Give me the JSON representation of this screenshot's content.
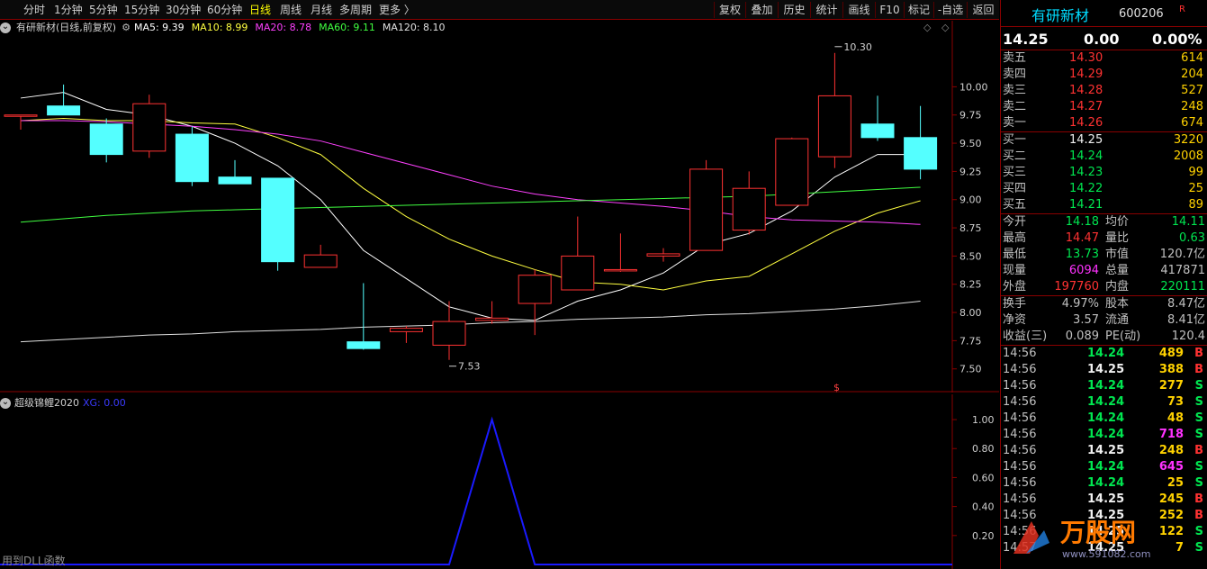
{
  "toolbar": {
    "tabs": [
      "分时",
      "1分钟",
      "5分钟",
      "15分钟",
      "30分钟",
      "60分钟",
      "日线",
      "周线",
      "月线",
      "多周期",
      "更多 〉"
    ],
    "active_tab": "日线",
    "tools": [
      "复权",
      "叠加",
      "历史",
      "统计",
      "画线",
      "F10",
      "标记",
      "-自选",
      "返回"
    ]
  },
  "main_legend": {
    "title": "有研新材(日线,前复权)",
    "ma": [
      {
        "label": "MA5: 9.39",
        "color": "#ffffff"
      },
      {
        "label": "MA10: 8.99",
        "color": "#ffff40"
      },
      {
        "label": "MA20: 8.78",
        "color": "#ff40ff"
      },
      {
        "label": "MA60: 9.11",
        "color": "#40ff40"
      },
      {
        "label": "MA120: 8.10",
        "color": "#e0e0e0"
      }
    ]
  },
  "sub_legend": {
    "title": "超级锦鲤2020",
    "xg": "XG: 0.00"
  },
  "chart_data": [
    {
      "type": "candlestick",
      "title": "有研新材(日线,前复权)",
      "ylim": [
        7.45,
        10.45
      ],
      "yticks": [
        "10.00",
        "9.75",
        "9.50",
        "9.25",
        "9.00",
        "8.75",
        "8.50",
        "8.25",
        "8.00",
        "7.75",
        "7.50"
      ],
      "annotations": [
        "10.30",
        "7.53"
      ],
      "candles": [
        {
          "o": 9.75,
          "h": 9.75,
          "l": 9.62,
          "c": 9.75
        },
        {
          "o": 9.83,
          "h": 10.02,
          "l": 9.75,
          "c": 9.75
        },
        {
          "o": 9.67,
          "h": 9.72,
          "l": 9.33,
          "c": 9.4
        },
        {
          "o": 9.43,
          "h": 9.93,
          "l": 9.37,
          "c": 9.85
        },
        {
          "o": 9.58,
          "h": 9.65,
          "l": 9.12,
          "c": 9.16
        },
        {
          "o": 9.2,
          "h": 9.35,
          "l": 9.14,
          "c": 9.14
        },
        {
          "o": 9.19,
          "h": 9.19,
          "l": 8.37,
          "c": 8.45
        },
        {
          "o": 8.4,
          "h": 8.6,
          "l": 8.4,
          "c": 8.51
        },
        {
          "o": 7.74,
          "h": 8.26,
          "l": 7.67,
          "c": 7.68
        },
        {
          "o": 7.83,
          "h": 7.88,
          "l": 7.73,
          "c": 7.86
        },
        {
          "o": 7.71,
          "h": 8.1,
          "l": 7.58,
          "c": 7.92
        },
        {
          "o": 7.93,
          "h": 8.1,
          "l": 7.9,
          "c": 7.95
        },
        {
          "o": 8.08,
          "h": 8.38,
          "l": 7.8,
          "c": 8.33
        },
        {
          "o": 8.2,
          "h": 8.85,
          "l": 8.2,
          "c": 8.5
        },
        {
          "o": 8.38,
          "h": 8.7,
          "l": 8.36,
          "c": 8.38
        },
        {
          "o": 8.5,
          "h": 8.57,
          "l": 8.45,
          "c": 8.52
        },
        {
          "o": 8.55,
          "h": 9.35,
          "l": 8.55,
          "c": 9.27
        },
        {
          "o": 8.73,
          "h": 9.25,
          "l": 8.69,
          "c": 9.1
        },
        {
          "o": 8.95,
          "h": 9.55,
          "l": 8.95,
          "c": 9.54
        },
        {
          "o": 9.38,
          "h": 10.3,
          "l": 9.28,
          "c": 9.92
        },
        {
          "o": 9.67,
          "h": 9.92,
          "l": 9.52,
          "c": 9.55
        },
        {
          "o": 9.55,
          "h": 9.83,
          "l": 9.18,
          "c": 9.27
        }
      ],
      "series": [
        {
          "name": "MA5",
          "color": "#ffffff",
          "values": [
            9.9,
            9.95,
            9.8,
            9.75,
            9.65,
            9.5,
            9.3,
            9.0,
            8.55,
            8.3,
            8.05,
            7.95,
            7.93,
            8.1,
            8.2,
            8.35,
            8.6,
            8.7,
            8.9,
            9.2,
            9.4,
            9.4
          ]
        },
        {
          "name": "MA10",
          "color": "#ffff40",
          "values": [
            9.7,
            9.72,
            9.7,
            9.7,
            9.68,
            9.67,
            9.55,
            9.4,
            9.1,
            8.85,
            8.65,
            8.5,
            8.38,
            8.27,
            8.25,
            8.2,
            8.28,
            8.32,
            8.52,
            8.72,
            8.88,
            8.99
          ]
        },
        {
          "name": "MA20",
          "color": "#ff40ff",
          "values": [
            9.7,
            9.7,
            9.69,
            9.67,
            9.65,
            9.62,
            9.58,
            9.52,
            9.42,
            9.32,
            9.22,
            9.12,
            9.05,
            9.0,
            8.97,
            8.94,
            8.9,
            8.85,
            8.82,
            8.81,
            8.8,
            8.78
          ]
        },
        {
          "name": "MA60",
          "color": "#40ff40",
          "values": [
            8.8,
            8.83,
            8.86,
            8.88,
            8.9,
            8.91,
            8.92,
            8.93,
            8.94,
            8.95,
            8.96,
            8.97,
            8.98,
            8.99,
            9.0,
            9.01,
            9.02,
            9.03,
            9.05,
            9.07,
            9.09,
            9.11
          ]
        },
        {
          "name": "MA120",
          "color": "#e0e0e0",
          "values": [
            7.74,
            7.76,
            7.78,
            7.8,
            7.81,
            7.83,
            7.84,
            7.85,
            7.87,
            7.88,
            7.89,
            7.91,
            7.92,
            7.94,
            7.95,
            7.96,
            7.98,
            7.99,
            8.01,
            8.03,
            8.06,
            8.1
          ]
        }
      ]
    },
    {
      "type": "line",
      "title": "超级锦鲤2020",
      "ylim": [
        0,
        1.05
      ],
      "yticks": [
        "1.00",
        "0.80",
        "0.60",
        "0.40",
        "0.20"
      ],
      "series": [
        {
          "name": "XG",
          "color": "#1a1aff",
          "values": [
            0,
            0,
            0,
            0,
            0,
            0,
            0,
            0,
            0,
            0,
            0,
            1,
            0,
            0,
            0,
            0,
            0,
            0,
            0,
            0,
            0,
            0
          ]
        }
      ]
    }
  ],
  "footer": "用到DLL函数",
  "quote": {
    "name": "有研新材",
    "code": "600206",
    "flag": "R",
    "price": "14.25",
    "change": "0.00",
    "pct": "0.00%",
    "asks": [
      {
        "label": "卖五",
        "price": "14.30",
        "vol": "614"
      },
      {
        "label": "卖四",
        "price": "14.29",
        "vol": "204"
      },
      {
        "label": "卖三",
        "price": "14.28",
        "vol": "527"
      },
      {
        "label": "卖二",
        "price": "14.27",
        "vol": "248"
      },
      {
        "label": "卖一",
        "price": "14.26",
        "vol": "674"
      }
    ],
    "bids": [
      {
        "label": "买一",
        "price": "14.25",
        "vol": "3220"
      },
      {
        "label": "买二",
        "price": "14.24",
        "vol": "2008"
      },
      {
        "label": "买三",
        "price": "14.23",
        "vol": "99"
      },
      {
        "label": "买四",
        "price": "14.22",
        "vol": "25"
      },
      {
        "label": "买五",
        "price": "14.21",
        "vol": "89"
      }
    ],
    "stats1": [
      {
        "l1": "今开",
        "v1": "14.18",
        "c1": "green",
        "l2": "均价",
        "v2": "14.11",
        "c2": "green"
      },
      {
        "l1": "最高",
        "v1": "14.47",
        "c1": "red",
        "l2": "量比",
        "v2": "0.63",
        "c2": "green"
      },
      {
        "l1": "最低",
        "v1": "13.73",
        "c1": "green",
        "l2": "市值",
        "v2": "120.7亿",
        "c2": "gray"
      },
      {
        "l1": "现量",
        "v1": "6094",
        "c1": "magenta",
        "l2": "总量",
        "v2": "417871",
        "c2": "gray"
      },
      {
        "l1": "外盘",
        "v1": "197760",
        "c1": "red",
        "l2": "内盘",
        "v2": "220111",
        "c2": "green"
      }
    ],
    "stats2": [
      {
        "l1": "换手",
        "v1": "4.97%",
        "l2": "股本",
        "v2": "8.47亿"
      },
      {
        "l1": "净资",
        "v1": "3.57",
        "l2": "流通",
        "v2": "8.41亿"
      },
      {
        "l1": "收益(三)",
        "v1": "0.089",
        "l2": "PE(动)",
        "v2": "120.4"
      }
    ],
    "ticks": [
      {
        "time": "14:56",
        "price": "14.24",
        "vol": "489",
        "bs": "B",
        "vc": "yellow"
      },
      {
        "time": "14:56",
        "price": "14.25",
        "vol": "388",
        "bs": "B",
        "vc": "yellow"
      },
      {
        "time": "14:56",
        "price": "14.24",
        "vol": "277",
        "bs": "S",
        "vc": "yellow"
      },
      {
        "time": "14:56",
        "price": "14.24",
        "vol": "73",
        "bs": "S",
        "vc": "yellow"
      },
      {
        "time": "14:56",
        "price": "14.24",
        "vol": "48",
        "bs": "S",
        "vc": "yellow"
      },
      {
        "time": "14:56",
        "price": "14.24",
        "vol": "718",
        "bs": "S",
        "vc": "magenta"
      },
      {
        "time": "14:56",
        "price": "14.25",
        "vol": "248",
        "bs": "B",
        "vc": "yellow"
      },
      {
        "time": "14:56",
        "price": "14.24",
        "vol": "645",
        "bs": "S",
        "vc": "magenta"
      },
      {
        "time": "14:56",
        "price": "14.24",
        "vol": "25",
        "bs": "S",
        "vc": "yellow"
      },
      {
        "time": "14:56",
        "price": "14.25",
        "vol": "245",
        "bs": "B",
        "vc": "yellow"
      },
      {
        "time": "14:56",
        "price": "14.25",
        "vol": "252",
        "bs": "B",
        "vc": "yellow"
      },
      {
        "time": "14:56",
        "price": "14.25",
        "vol": "122",
        "bs": "S",
        "vc": "yellow"
      },
      {
        "time": "14:57",
        "price": "14.25",
        "vol": "7",
        "bs": "S",
        "vc": "yellow"
      }
    ]
  },
  "watermark": {
    "text": "万股网",
    "sub": "www.591082.com"
  }
}
